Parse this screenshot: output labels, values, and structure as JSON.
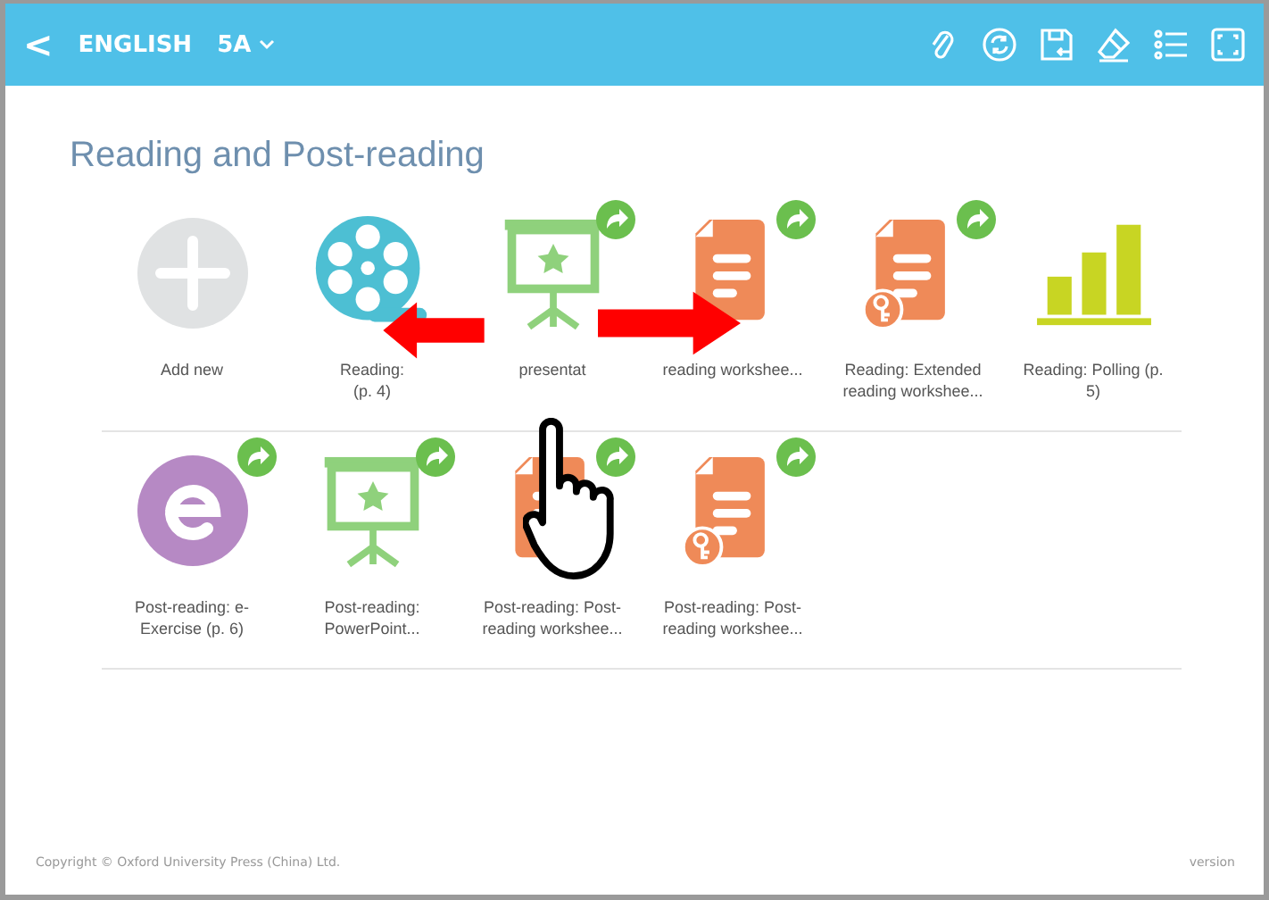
{
  "header": {
    "back": "<",
    "subject": "ENGLISH",
    "grade": "5A"
  },
  "section_title": "Reading and Post-reading",
  "rows": [
    {
      "items": [
        {
          "kind": "add",
          "shared": false,
          "label": [
            "Add new"
          ]
        },
        {
          "kind": "video",
          "shared": false,
          "label": [
            "Reading:",
            "(p. 4)"
          ]
        },
        {
          "kind": "ppt",
          "shared": true,
          "label": [
            "presentat"
          ]
        },
        {
          "kind": "worksheet",
          "shared": true,
          "label": [
            "reading workshee..."
          ]
        },
        {
          "kind": "worksheet-key",
          "shared": true,
          "label": [
            "Reading: Extended",
            "reading workshee..."
          ]
        },
        {
          "kind": "poll",
          "shared": false,
          "label": [
            "Reading: Polling (p.",
            "5)"
          ]
        }
      ]
    },
    {
      "items": [
        {
          "kind": "eexercise",
          "shared": true,
          "label": [
            "Post-reading: e-",
            "Exercise (p. 6)"
          ]
        },
        {
          "kind": "ppt",
          "shared": true,
          "label": [
            "Post-reading:",
            "PowerPoint..."
          ]
        },
        {
          "kind": "worksheet",
          "shared": true,
          "label": [
            "Post-reading: Post-",
            "reading workshee..."
          ]
        },
        {
          "kind": "worksheet-key",
          "shared": true,
          "label": [
            "Post-reading: Post-",
            "reading workshee..."
          ]
        }
      ]
    }
  ],
  "footer": {
    "copyright": "Copyright © Oxford University Press (China) Ltd.",
    "version": "version"
  }
}
